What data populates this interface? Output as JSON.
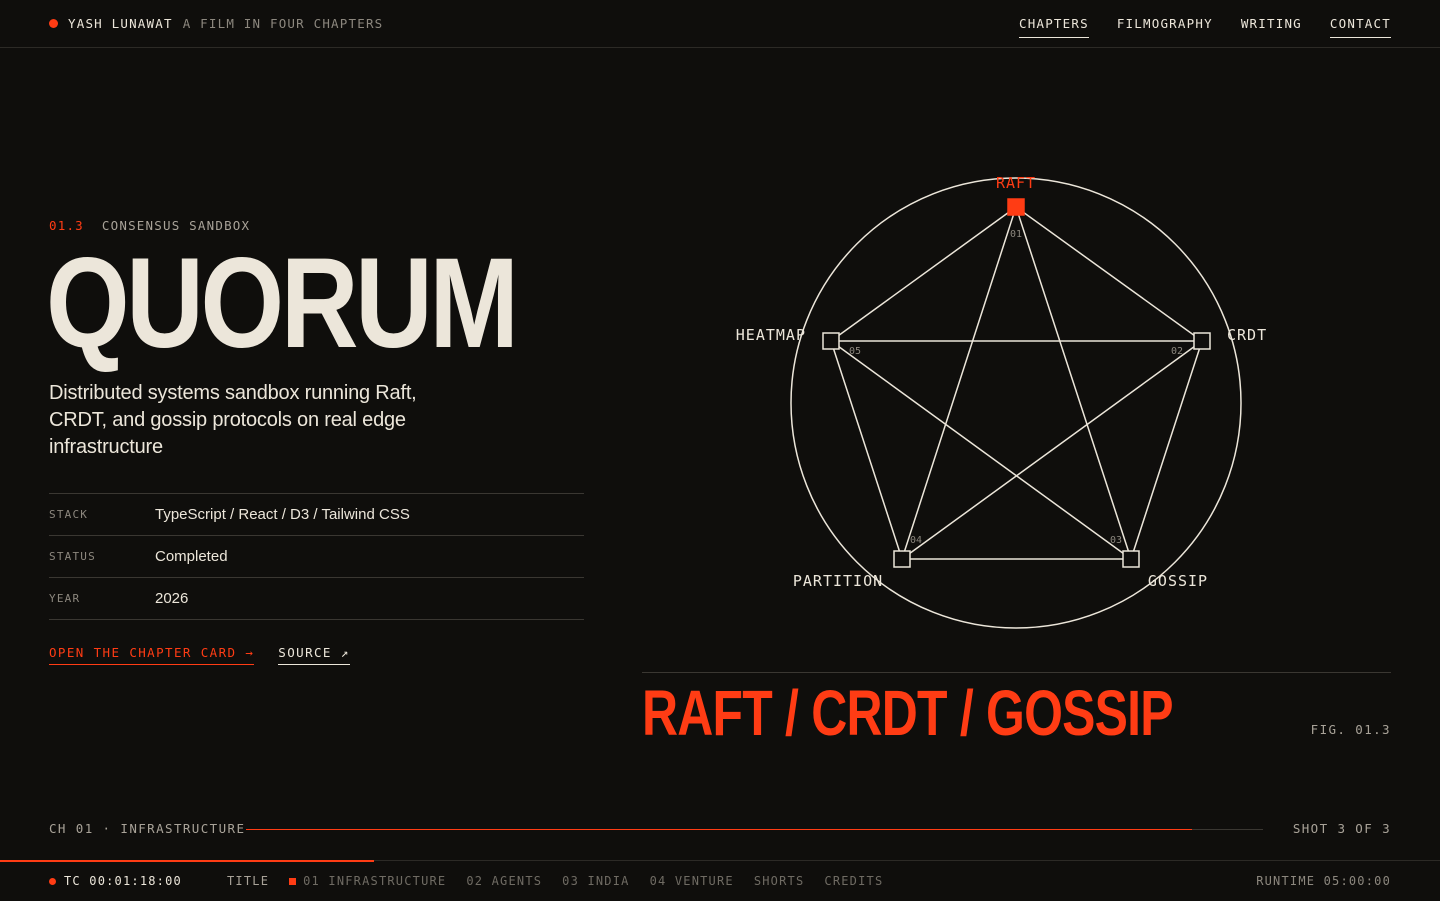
{
  "header": {
    "name": "YASH LUNAWAT",
    "tagline": "A FILM IN FOUR CHAPTERS",
    "nav": [
      "CHAPTERS",
      "FILMOGRAPHY",
      "WRITING",
      "CONTACT"
    ]
  },
  "project": {
    "number": "01.3",
    "eyebrow": "CONSENSUS SANDBOX",
    "title": "QUORUM",
    "description": "Distributed systems sandbox running Raft, CRDT, and gossip protocols on real edge infrastructure",
    "meta": [
      {
        "key": "STACK",
        "value": "TypeScript / React / D3 / Tailwind CSS"
      },
      {
        "key": "STATUS",
        "value": "Completed"
      },
      {
        "key": "YEAR",
        "value": "2026"
      }
    ],
    "links": {
      "primary": "OPEN THE CHAPTER CARD →",
      "secondary": "SOURCE ↗"
    }
  },
  "diagram": {
    "nodes": [
      {
        "label": "RAFT",
        "index": "01",
        "active": true
      },
      {
        "label": "CRDT",
        "index": "02",
        "active": false
      },
      {
        "label": "GOSSIP",
        "index": "03",
        "active": false
      },
      {
        "label": "PARTITION",
        "index": "04",
        "active": false
      },
      {
        "label": "HEATMAP",
        "index": "05",
        "active": false
      }
    ],
    "caption": "RAFT / CRDT / GOSSIP",
    "fig_label": "FIG. 01.3"
  },
  "chapter": {
    "label": "CH 01 · INFRASTRUCTURE",
    "shot": "SHOT 3 OF 3",
    "progress": 0.93
  },
  "timeline": {
    "timecode": "TC 00:01:18:00",
    "chapters": [
      {
        "label": "TITLE",
        "state": "done"
      },
      {
        "label": "01 INFRASTRUCTURE",
        "state": "current"
      },
      {
        "label": "02 AGENTS",
        "state": "upcoming"
      },
      {
        "label": "03 INDIA",
        "state": "upcoming"
      },
      {
        "label": "04 VENTURE",
        "state": "upcoming"
      },
      {
        "label": "SHORTS",
        "state": "upcoming"
      },
      {
        "label": "CREDITS",
        "state": "upcoming"
      }
    ],
    "runtime": "RUNTIME 05:00:00",
    "progress": 0.26
  },
  "colors": {
    "background": "#0f0e0c",
    "foreground": "#ece6da",
    "accent": "#ff3c14"
  }
}
